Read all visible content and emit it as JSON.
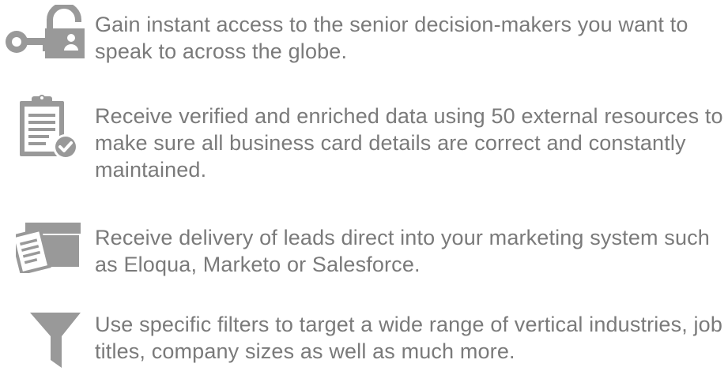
{
  "colors": {
    "icon": "#999999",
    "text": "#7a7a7a",
    "background": "#ffffff"
  },
  "features": [
    {
      "icon": "key-lock-icon",
      "text": "Gain instant access to the senior decision-makers you want to speak to across the globe."
    },
    {
      "icon": "clipboard-check-icon",
      "text": "Receive verified and enriched data using 50 external resources to make sure all business card details are correct and constantly maintained."
    },
    {
      "icon": "box-delivery-icon",
      "text": "Receive delivery of leads direct into your marketing system such as Eloqua, Marketo or Salesforce."
    },
    {
      "icon": "filter-funnel-icon",
      "text": "Use specific filters to target a wide range of vertical industries, job titles, company sizes as well as much more."
    }
  ]
}
